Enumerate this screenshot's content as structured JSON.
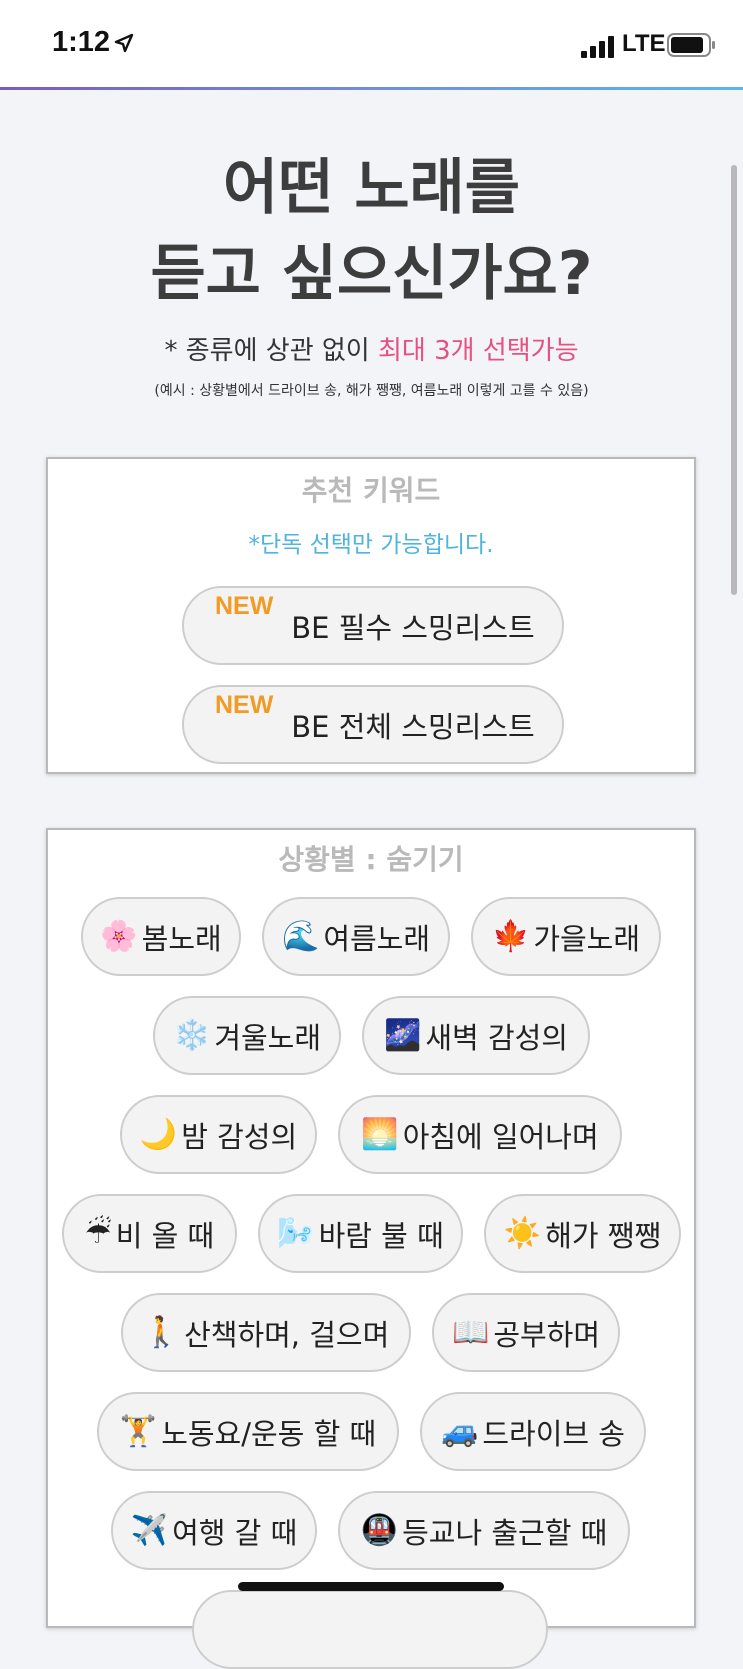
{
  "status_bar": {
    "time": "1:12",
    "network": "LTE"
  },
  "title_line1": "어떤 노래를",
  "title_line2": "듣고 싶으신가요?",
  "subtitle_prefix": "* 종류에 상관 없이 ",
  "subtitle_highlight": "최대 3개 선택가능",
  "example": "(예시 : 상황별에서 드라이브 송, 해가 쨍쨍, 여름노래 이렇게 고를 수 있음)",
  "recommended": {
    "title": "추천 키워드",
    "notice": "*단독 선택만 가능합니다.",
    "items": [
      {
        "tag": "NEW",
        "label": "BE 필수 스밍리스트"
      },
      {
        "tag": "NEW",
        "label": "BE 전체 스밍리스트"
      }
    ]
  },
  "situations": {
    "title": "상황별 : 숨기기",
    "items": [
      {
        "emoji": "🌸",
        "label": "봄노래"
      },
      {
        "emoji": "🌊",
        "label": "여름노래"
      },
      {
        "emoji": "🍁",
        "label": "가을노래"
      },
      {
        "emoji": "❄️",
        "label": "겨울노래"
      },
      {
        "emoji": "🌌",
        "label": "새벽 감성의"
      },
      {
        "emoji": "🌙",
        "label": "밤 감성의"
      },
      {
        "emoji": "🌅",
        "label": "아침에 일어나며"
      },
      {
        "emoji": "☔",
        "label": "비 올 때"
      },
      {
        "emoji": "🌬️",
        "label": "바람 불 때"
      },
      {
        "emoji": "☀️",
        "label": "해가 쨍쨍"
      },
      {
        "emoji": "🚶",
        "label": "산책하며, 걸으며"
      },
      {
        "emoji": "📖",
        "label": "공부하며"
      },
      {
        "emoji": "🏋️",
        "label": "노동요/운동 할 때"
      },
      {
        "emoji": "🚙",
        "label": "드라이브 송"
      },
      {
        "emoji": "✈️",
        "label": "여행 갈 때"
      },
      {
        "emoji": "🚇",
        "label": "등교나 출근할 때"
      }
    ]
  }
}
